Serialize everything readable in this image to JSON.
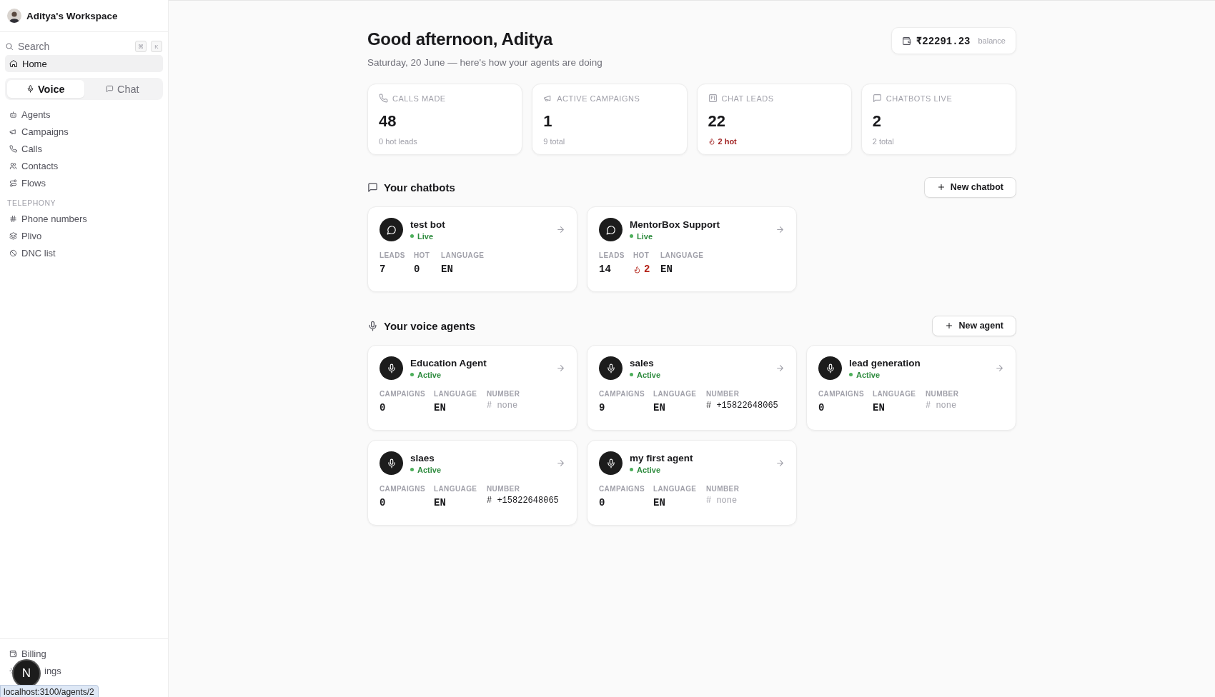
{
  "sidebar": {
    "workspace": "Aditya's Workspace",
    "search": {
      "placeholder": "Search",
      "shortcut": [
        "⌘",
        "K"
      ]
    },
    "home": {
      "label": "Home",
      "selected": true
    },
    "mode_tabs": [
      {
        "label": "Voice",
        "selected": true
      },
      {
        "label": "Chat",
        "selected": false
      }
    ],
    "nav": [
      {
        "items": [
          "Agents",
          "Campaigns",
          "Calls",
          "Contacts",
          "Flows"
        ]
      },
      {
        "heading": "TELEPHONY",
        "items": [
          "Phone numbers",
          "Plivo",
          "DNC list"
        ]
      }
    ],
    "bottom_items": [
      "Billing",
      "ings"
    ],
    "dev_badge": "N",
    "link_preview": "localhost:3100/agents/2"
  },
  "header": {
    "greeting": "Good afternoon, Aditya",
    "subtitle": "Saturday, 20 June — here's how your agents are doing",
    "balance": {
      "amount": "₹22291.23",
      "label": "balance"
    }
  },
  "stats": [
    {
      "label": "CALLS MADE",
      "value": "48",
      "note": "0 hot leads",
      "hot": false
    },
    {
      "label": "ACTIVE CAMPAIGNS",
      "value": "1",
      "note": "9 total",
      "hot": false
    },
    {
      "label": "CHAT LEADS",
      "value": "22",
      "note": "2 hot",
      "hot": true
    },
    {
      "label": "CHATBOTS LIVE",
      "value": "2",
      "note": "2 total",
      "hot": false
    }
  ],
  "chatbots": {
    "title": "Your chatbots",
    "button": "New chatbot",
    "items": [
      {
        "name": "test bot",
        "status": "Live",
        "stats": [
          {
            "label": "LEADS",
            "value": "7",
            "hot": false
          },
          {
            "label": "HOT",
            "value": "0",
            "hot": false
          },
          {
            "label": "LANGUAGE",
            "value": "EN",
            "hot": false
          }
        ]
      },
      {
        "name": "MentorBox Support",
        "status": "Live",
        "stats": [
          {
            "label": "LEADS",
            "value": "14",
            "hot": false
          },
          {
            "label": "HOT",
            "value": "2",
            "hot": true
          },
          {
            "label": "LANGUAGE",
            "value": "EN",
            "hot": false
          }
        ]
      }
    ]
  },
  "voice_agents": {
    "title": "Your voice agents",
    "button": "New agent",
    "items": [
      {
        "name": "Education Agent",
        "status": "Active",
        "stats": [
          {
            "label": "CAMPAIGNS",
            "value": "0"
          },
          {
            "label": "LANGUAGE",
            "value": "EN"
          },
          {
            "label": "NUMBER",
            "value": "# none",
            "assigned": false
          }
        ]
      },
      {
        "name": "sales",
        "status": "Active",
        "stats": [
          {
            "label": "CAMPAIGNS",
            "value": "9"
          },
          {
            "label": "LANGUAGE",
            "value": "EN"
          },
          {
            "label": "NUMBER",
            "value": "# +15822648065",
            "assigned": true
          }
        ]
      },
      {
        "name": "lead generation",
        "status": "Active",
        "stats": [
          {
            "label": "CAMPAIGNS",
            "value": "0"
          },
          {
            "label": "LANGUAGE",
            "value": "EN"
          },
          {
            "label": "NUMBER",
            "value": "# none",
            "assigned": false
          }
        ]
      },
      {
        "name": "slaes",
        "status": "Active",
        "stats": [
          {
            "label": "CAMPAIGNS",
            "value": "0"
          },
          {
            "label": "LANGUAGE",
            "value": "EN"
          },
          {
            "label": "NUMBER",
            "value": "# +15822648065",
            "assigned": true
          }
        ]
      },
      {
        "name": "my first agent",
        "status": "Active",
        "stats": [
          {
            "label": "CAMPAIGNS",
            "value": "0"
          },
          {
            "label": "LANGUAGE",
            "value": "EN"
          },
          {
            "label": "NUMBER",
            "value": "# none",
            "assigned": false
          }
        ]
      }
    ]
  }
}
